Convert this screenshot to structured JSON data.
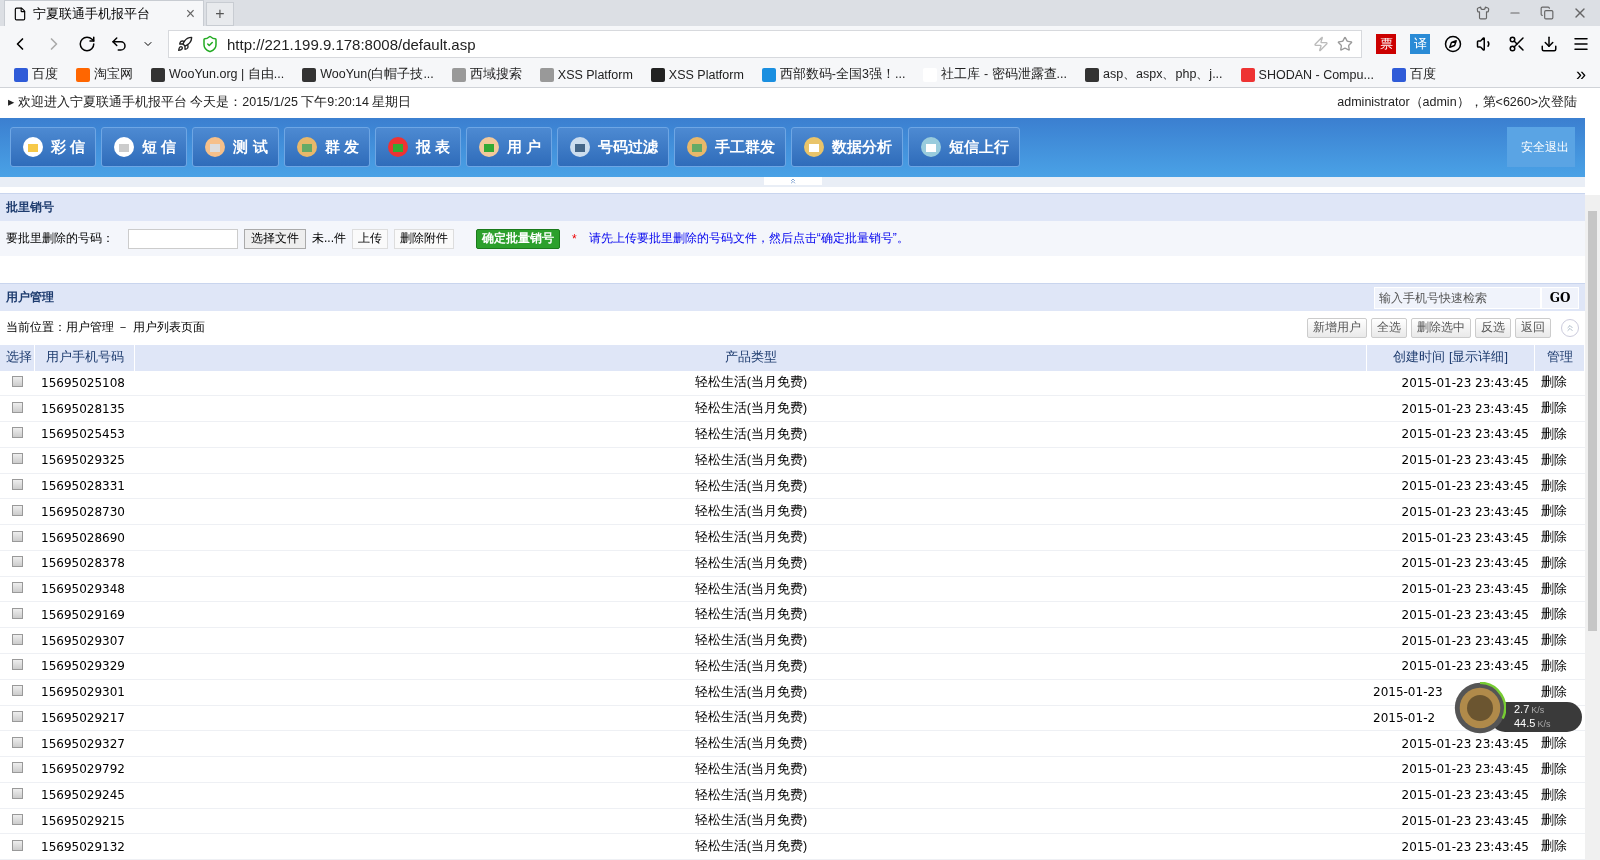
{
  "browser": {
    "tab": {
      "title": "宁夏联通手机报平台",
      "close": "×"
    },
    "new_tab": "+",
    "address": "http://221.199.9.178:8008/default.asp",
    "extension_icons": [
      {
        "glyph": "票"
      },
      {
        "glyph": "译"
      }
    ],
    "bookmarks": [
      "百度",
      "淘宝网",
      "WooYun.org | 自由...",
      "WooYun(白帽子技...",
      "西域搜索",
      "XSS Platform",
      "XSS Platform",
      "西部数码-全国3强！...",
      "社工库 - 密码泄露查...",
      "asp、aspx、php、j...",
      "SHODAN - Compu...",
      "百度"
    ],
    "more": "»"
  },
  "welcome": {
    "marker": "▸",
    "text": "欢迎进入宁夏联通手机报平台 今天是：2015/1/25 下午9:20:14 星期日",
    "user": "administrator（admin），第<6260>次登陆"
  },
  "nav": {
    "items": [
      "彩 信",
      "短 信",
      "测 试",
      "群 发",
      "报 表",
      "用 户",
      "号码过滤",
      "手工群发",
      "数据分析",
      "短信上行"
    ],
    "logout": "安全退出"
  },
  "batch": {
    "title": "批里销号",
    "label": "要批里删除的号码：",
    "file_button": "选择文件",
    "file_name": "未...件",
    "upload": "上传",
    "delete_attachment": "删除附件",
    "confirm": "确定批量销号",
    "required_mark": "*",
    "hint": "请先上传要批里删除的号码文件，然后点击“确定批量销号”。"
  },
  "users": {
    "title": "用户管理",
    "search": {
      "placeholder": "输入手机号快速检索",
      "go": "GO"
    },
    "breadcrumb": "当前位置：用户管理 － 用户列表页面",
    "actions": [
      "新增用户",
      "全选",
      "删除选中",
      "反选",
      "返回"
    ],
    "table": {
      "columns": [
        "选择",
        "用户手机号码",
        "产品类型",
        "创建时间",
        "[显示详细]",
        "管理"
      ],
      "rows": [
        {
          "phone": "15695025108",
          "product": "轻松生活(当月免费)",
          "created": "2015-01-23 23:43:45",
          "action": "删除",
          "checked": false
        },
        {
          "phone": "15695028135",
          "product": "轻松生活(当月免费)",
          "created": "2015-01-23 23:43:45",
          "action": "删除",
          "checked": false
        },
        {
          "phone": "15695025453",
          "product": "轻松生活(当月免费)",
          "created": "2015-01-23 23:43:45",
          "action": "删除",
          "checked": false
        },
        {
          "phone": "15695029325",
          "product": "轻松生活(当月免费)",
          "created": "2015-01-23 23:43:45",
          "action": "删除",
          "checked": false
        },
        {
          "phone": "15695028331",
          "product": "轻松生活(当月免费)",
          "created": "2015-01-23 23:43:45",
          "action": "删除",
          "checked": false
        },
        {
          "phone": "15695028730",
          "product": "轻松生活(当月免费)",
          "created": "2015-01-23 23:43:45",
          "action": "删除",
          "checked": false
        },
        {
          "phone": "15695028690",
          "product": "轻松生活(当月免费)",
          "created": "2015-01-23 23:43:45",
          "action": "删除",
          "checked": false
        },
        {
          "phone": "15695028378",
          "product": "轻松生活(当月免费)",
          "created": "2015-01-23 23:43:45",
          "action": "删除",
          "checked": false
        },
        {
          "phone": "15695029348",
          "product": "轻松生活(当月免费)",
          "created": "2015-01-23 23:43:45",
          "action": "删除",
          "checked": false
        },
        {
          "phone": "15695029169",
          "product": "轻松生活(当月免费)",
          "created": "2015-01-23 23:43:45",
          "action": "删除",
          "checked": false
        },
        {
          "phone": "15695029307",
          "product": "轻松生活(当月免费)",
          "created": "2015-01-23 23:43:45",
          "action": "删除",
          "checked": false
        },
        {
          "phone": "15695029329",
          "product": "轻松生活(当月免费)",
          "created": "2015-01-23 23:43:45",
          "action": "删除",
          "checked": false
        },
        {
          "phone": "15695029301",
          "product": "轻松生活(当月免费)",
          "created": "2015-01-23",
          "action": "删除",
          "checked": false
        },
        {
          "phone": "15695029217",
          "product": "轻松生活(当月免费)",
          "created": "2015-01-2",
          "checked": false
        },
        {
          "phone": "15695029327",
          "product": "轻松生活(当月免费)",
          "created": "2015-01-23 23:43:45",
          "action": "删除",
          "checked": false
        },
        {
          "phone": "15695029792",
          "product": "轻松生活(当月免费)",
          "created": "2015-01-23 23:43:45",
          "action": "删除",
          "checked": false
        },
        {
          "phone": "15695029245",
          "product": "轻松生活(当月免费)",
          "created": "2015-01-23 23:43:45",
          "action": "删除",
          "checked": false
        },
        {
          "phone": "15695029215",
          "product": "轻松生活(当月免费)",
          "created": "2015-01-23 23:43:45",
          "action": "删除",
          "checked": false
        },
        {
          "phone": "15695029132",
          "product": "轻松生活(当月免费)",
          "created": "2015-01-23 23:43:45",
          "action": "删除",
          "checked": false
        }
      ]
    }
  },
  "speed_widget": {
    "upload": "2.7",
    "upload_unit": "K/s",
    "download": "44.5",
    "download_unit": "K/s"
  }
}
